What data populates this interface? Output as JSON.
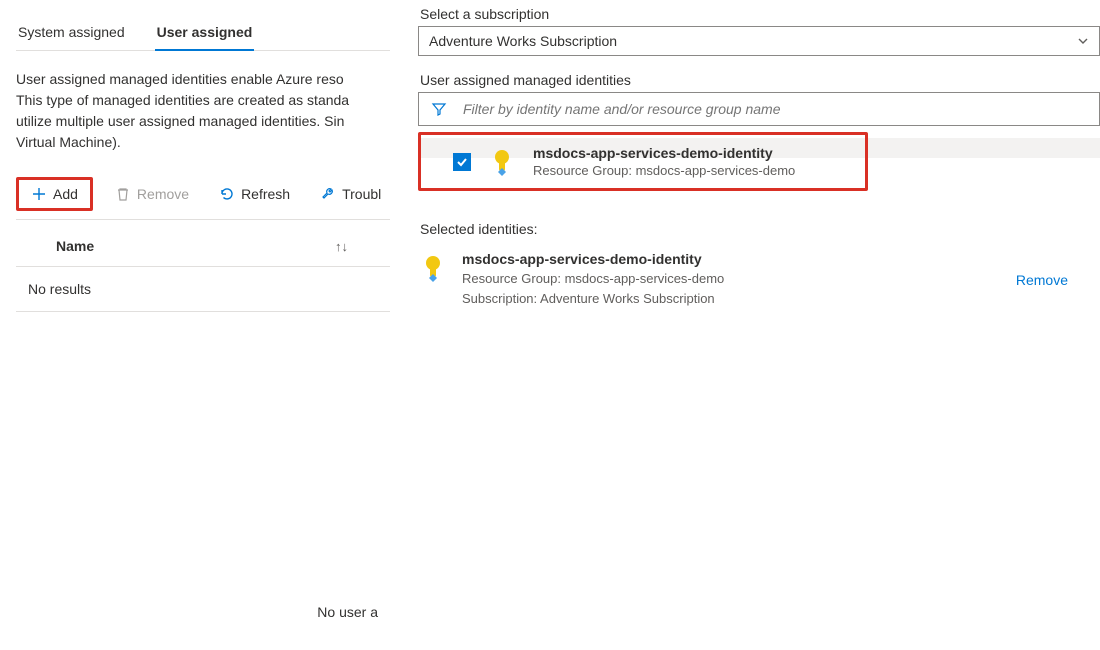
{
  "tabs": {
    "system": "System assigned",
    "user": "User assigned"
  },
  "description": {
    "line1": "User assigned managed identities enable Azure reso",
    "line2": "This type of managed identities are created as standa",
    "line3": "utilize multiple user assigned managed identities. Sin",
    "line4": "Virtual Machine)."
  },
  "toolbar": {
    "add": "Add",
    "remove": "Remove",
    "refresh": "Refresh",
    "troubleshoot": "Troubl"
  },
  "table": {
    "header_name": "Name",
    "no_results": "No results",
    "empty": "No user a"
  },
  "right": {
    "subscription_label": "Select a subscription",
    "subscription_value": "Adventure Works Subscription",
    "identities_label": "User assigned managed identities",
    "filter_placeholder": "Filter by identity name and/or resource group name",
    "selected_title": "Selected identities:",
    "remove_link": "Remove"
  },
  "identity": {
    "name": "msdocs-app-services-demo-identity",
    "rg_label": "Resource Group: msdocs-app-services-demo",
    "sub_label": "Subscription: Adventure Works Subscription"
  }
}
